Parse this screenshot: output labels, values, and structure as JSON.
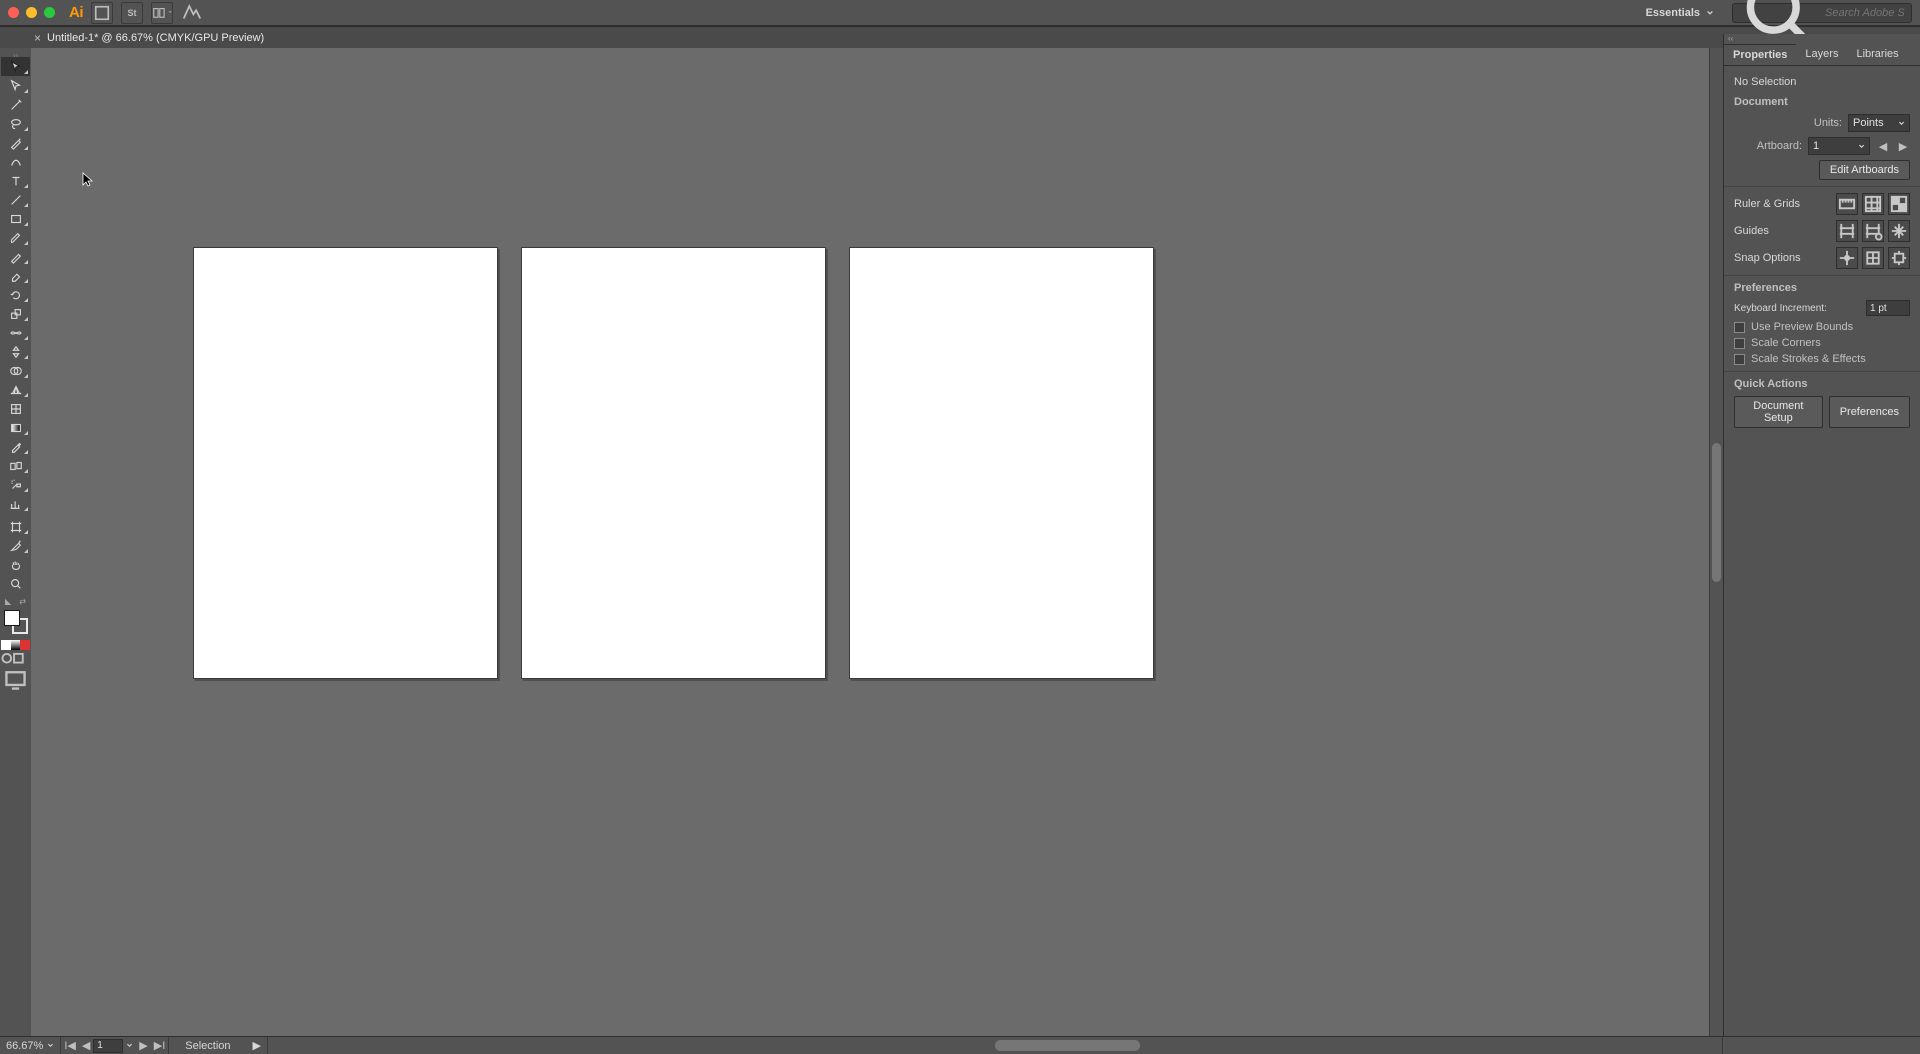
{
  "app": {
    "name": "Ai"
  },
  "workspace": {
    "label": "Essentials"
  },
  "search": {
    "placeholder": "Search Adobe Stock"
  },
  "document": {
    "title": "Untitled-1* @ 66.67% (CMYK/GPU Preview)"
  },
  "panel": {
    "tabs": [
      "Properties",
      "Layers",
      "Libraries"
    ],
    "selection_status": "No Selection",
    "document_label": "Document",
    "units_label": "Units:",
    "units_value": "Points",
    "artboard_label": "Artboard:",
    "artboard_value": "1",
    "edit_artboards": "Edit Artboards",
    "ruler_grids": "Ruler & Grids",
    "guides": "Guides",
    "snap_options": "Snap Options",
    "preferences_header": "Preferences",
    "kbd_incr_label": "Keyboard Increment:",
    "kbd_incr_value": "1 pt",
    "chk_preview": "Use Preview Bounds",
    "chk_scale_corners": "Scale Corners",
    "chk_scale_strokes": "Scale Strokes & Effects",
    "quick_actions": "Quick Actions",
    "doc_setup": "Document Setup",
    "preferences_btn": "Preferences"
  },
  "status": {
    "zoom": "66.67%",
    "artboard": "1",
    "tool": "Selection"
  }
}
